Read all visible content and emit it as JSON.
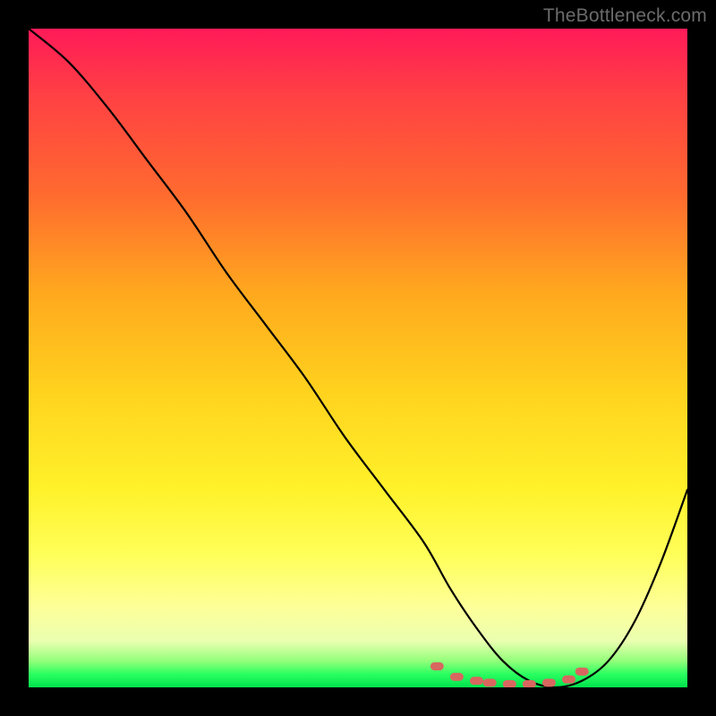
{
  "watermark": "TheBottleneck.com",
  "chart_data": {
    "type": "line",
    "title": "",
    "xlabel": "",
    "ylabel": "",
    "xlim": [
      0,
      100
    ],
    "ylim": [
      0,
      100
    ],
    "series": [
      {
        "name": "bottleneck-curve",
        "color": "#000000",
        "x": [
          0,
          6,
          12,
          18,
          24,
          30,
          36,
          42,
          48,
          54,
          60,
          64,
          68,
          72,
          76,
          80,
          84,
          88,
          92,
          96,
          100
        ],
        "y": [
          100,
          95,
          88,
          80,
          72,
          63,
          55,
          47,
          38,
          30,
          22,
          15,
          9,
          4,
          1,
          0,
          1,
          4,
          10,
          19,
          30
        ]
      }
    ],
    "markers": {
      "name": "optimal-range-dots",
      "color": "#d8675f",
      "x": [
        62,
        65,
        68,
        70,
        73,
        76,
        79,
        82,
        84
      ],
      "y": [
        3.2,
        1.6,
        1.0,
        0.7,
        0.5,
        0.5,
        0.7,
        1.2,
        2.4
      ]
    }
  }
}
